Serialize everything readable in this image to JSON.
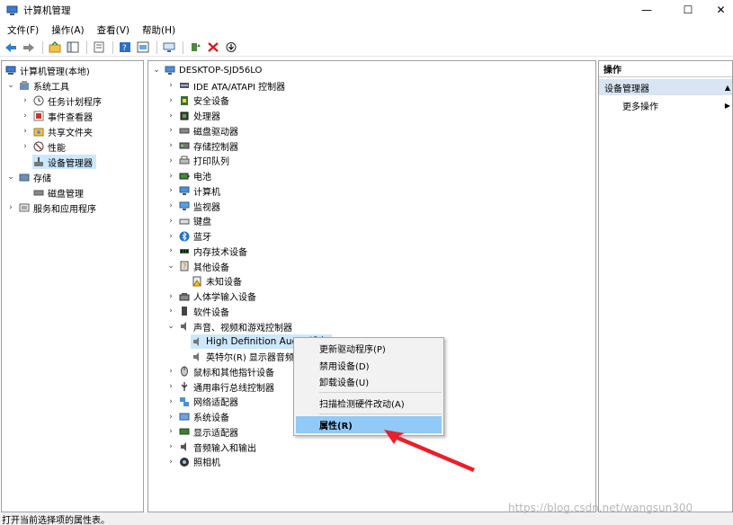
{
  "window": {
    "title": "计算机管理",
    "minimize": "—",
    "maximize": "☐",
    "close": "✕"
  },
  "menu": [
    "文件(F)",
    "操作(A)",
    "查看(V)",
    "帮助(H)"
  ],
  "left_tree": [
    {
      "label": "计算机管理(本地)",
      "arrow": "",
      "icon": "computer-management-icon"
    },
    {
      "label": "系统工具",
      "arrow": "⌄",
      "icon": "system-tools-icon"
    },
    {
      "label": "任务计划程序",
      "arrow": "›",
      "icon": "clock-icon"
    },
    {
      "label": "事件查看器",
      "arrow": "›",
      "icon": "event-viewer-icon"
    },
    {
      "label": "共享文件夹",
      "arrow": "›",
      "icon": "shared-folder-icon"
    },
    {
      "label": "性能",
      "arrow": "›",
      "icon": "performance-icon"
    },
    {
      "label": "设备管理器",
      "arrow": "",
      "icon": "device-manager-icon"
    },
    {
      "label": "存储",
      "arrow": "⌄",
      "icon": "storage-icon"
    },
    {
      "label": "磁盘管理",
      "arrow": "",
      "icon": "disk-icon"
    },
    {
      "label": "服务和应用程序",
      "arrow": "›",
      "icon": "services-icon"
    }
  ],
  "device_tree": {
    "root": "DESKTOP-SJD56LO",
    "items": [
      {
        "label": "IDE ATA/ATAPI 控制器",
        "arrow": "›",
        "icon": "ide-icon"
      },
      {
        "label": "安全设备",
        "arrow": "›",
        "icon": "security-device-icon"
      },
      {
        "label": "处理器",
        "arrow": "›",
        "icon": "processor-icon"
      },
      {
        "label": "磁盘驱动器",
        "arrow": "›",
        "icon": "disk-drive-icon"
      },
      {
        "label": "存储控制器",
        "arrow": "›",
        "icon": "storage-controller-icon"
      },
      {
        "label": "打印队列",
        "arrow": "›",
        "icon": "printer-icon"
      },
      {
        "label": "电池",
        "arrow": "›",
        "icon": "battery-icon"
      },
      {
        "label": "计算机",
        "arrow": "›",
        "icon": "computer-icon"
      },
      {
        "label": "监视器",
        "arrow": "›",
        "icon": "monitor-icon"
      },
      {
        "label": "键盘",
        "arrow": "›",
        "icon": "keyboard-icon"
      },
      {
        "label": "蓝牙",
        "arrow": "›",
        "icon": "bluetooth-icon"
      },
      {
        "label": "内存技术设备",
        "arrow": "›",
        "icon": "memory-icon"
      },
      {
        "label": "其他设备",
        "arrow": "⌄",
        "icon": "other-devices-icon"
      },
      {
        "label": "未知设备",
        "arrow": "",
        "icon": "unknown-device-icon",
        "child": true
      },
      {
        "label": "人体学输入设备",
        "arrow": "›",
        "icon": "hid-icon"
      },
      {
        "label": "软件设备",
        "arrow": "›",
        "icon": "software-device-icon"
      },
      {
        "label": "声音、视频和游戏控制器",
        "arrow": "⌄",
        "icon": "speaker-icon"
      },
      {
        "label": "High Definition Audio 设备",
        "arrow": "",
        "icon": "audio-device-icon",
        "child": true,
        "selected": true
      },
      {
        "label": "英特尔(R) 显示器音频",
        "arrow": "",
        "icon": "audio-device-icon",
        "child": true
      },
      {
        "label": "鼠标和其他指针设备",
        "arrow": "›",
        "icon": "mouse-icon"
      },
      {
        "label": "通用串行总线控制器",
        "arrow": "›",
        "icon": "usb-icon"
      },
      {
        "label": "网络适配器",
        "arrow": "›",
        "icon": "network-adapter-icon"
      },
      {
        "label": "系统设备",
        "arrow": "›",
        "icon": "system-device-icon"
      },
      {
        "label": "显示适配器",
        "arrow": "›",
        "icon": "display-adapter-icon"
      },
      {
        "label": "音频输入和输出",
        "arrow": "›",
        "icon": "audio-io-icon"
      },
      {
        "label": "照相机",
        "arrow": "›",
        "icon": "camera-icon"
      }
    ]
  },
  "actions": {
    "header": "操作",
    "section": "设备管理器",
    "more": "更多操作"
  },
  "context_menu": {
    "update_driver": "更新驱动程序(P)",
    "disable": "禁用设备(D)",
    "uninstall": "卸载设备(U)",
    "scan": "扫描检测硬件改动(A)",
    "properties": "属性(R)"
  },
  "status": "打开当前选择项的属性表。",
  "watermark": "https://blog.csdn.net/wangsun300",
  "colors": {
    "selection": "#cce8ff",
    "menu_highlight": "#91c9f7",
    "annotation_arrow": "#e8202a"
  }
}
